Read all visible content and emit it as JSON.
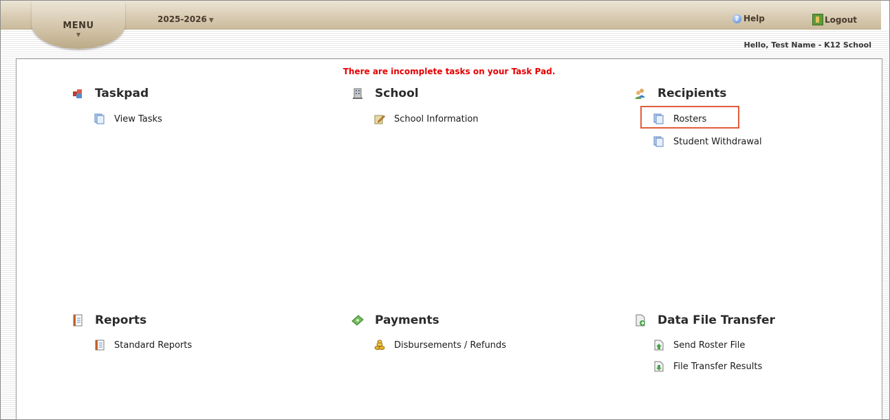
{
  "header": {
    "menu_label": "MENU",
    "year_label": "2025-2026",
    "help_label": "Help",
    "logout_label": "Logout",
    "greeting": "Hello, Test Name - K12 School"
  },
  "alert": "There are incomplete tasks on your Task Pad.",
  "sections": {
    "taskpad": {
      "title": "Taskpad",
      "items": [
        "View Tasks"
      ]
    },
    "school": {
      "title": "School",
      "items": [
        "School Information"
      ]
    },
    "recipients": {
      "title": "Recipients",
      "items": [
        "Rosters",
        "Student Withdrawal"
      ]
    },
    "reports": {
      "title": "Reports",
      "items": [
        "Standard Reports"
      ]
    },
    "payments": {
      "title": "Payments",
      "items": [
        "Disbursements / Refunds"
      ]
    },
    "data_file_transfer": {
      "title": "Data File Transfer",
      "items": [
        "Send Roster File",
        "File Transfer Results"
      ]
    }
  },
  "colors": {
    "alert": "#e50000",
    "highlight": "#e35b3a",
    "header": "#d9ccb3"
  }
}
